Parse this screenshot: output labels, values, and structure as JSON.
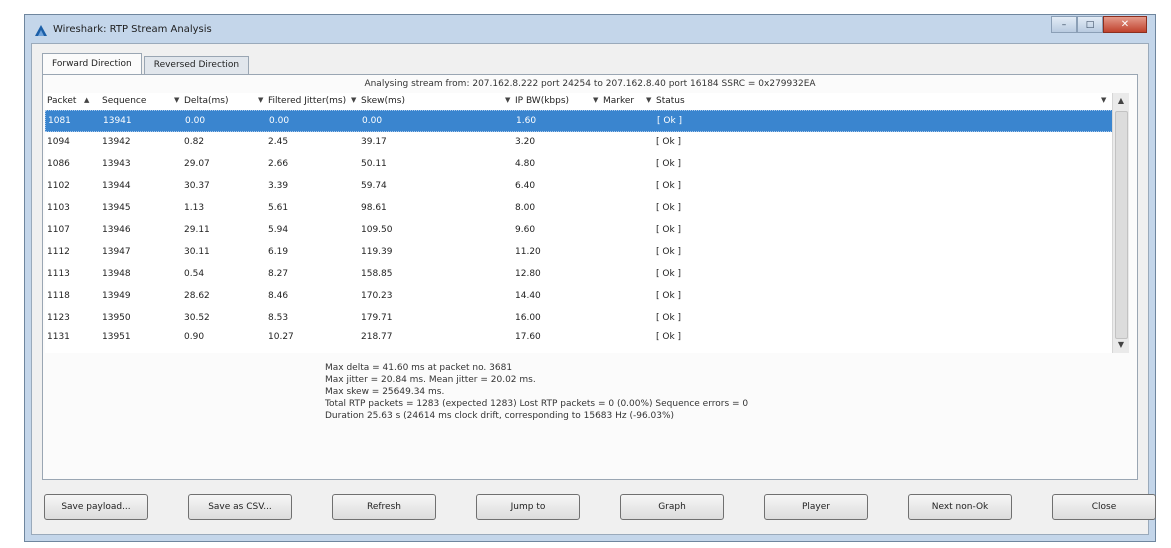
{
  "window": {
    "title": "Wireshark: RTP Stream Analysis",
    "controls": {
      "minimize": "–",
      "maximize": "□",
      "close": "✕"
    }
  },
  "tabs": [
    {
      "label": "Forward Direction",
      "active": true
    },
    {
      "label": "Reversed Direction",
      "active": false
    }
  ],
  "stream_info": "Analysing stream from: 207.162.8.222 port 24254 to 207.162.8.40 port 16184 SSRC = 0x279932EA",
  "table": {
    "columns": [
      "Packet",
      "Sequence",
      "Delta(ms)",
      "Filtered Jitter(ms)",
      "Skew(ms)",
      "IP BW(kbps)",
      "Marker",
      "Status"
    ],
    "rows": [
      [
        "1081",
        "13941",
        "0.00",
        "0.00",
        "0.00",
        "1.60",
        "",
        "[ Ok ]"
      ],
      [
        "1094",
        "13942",
        "0.82",
        "2.45",
        "39.17",
        "3.20",
        "",
        "[ Ok ]"
      ],
      [
        "1086",
        "13943",
        "29.07",
        "2.66",
        "50.11",
        "4.80",
        "",
        "[ Ok ]"
      ],
      [
        "1102",
        "13944",
        "30.37",
        "3.39",
        "59.74",
        "6.40",
        "",
        "[ Ok ]"
      ],
      [
        "1103",
        "13945",
        "1.13",
        "5.61",
        "98.61",
        "8.00",
        "",
        "[ Ok ]"
      ],
      [
        "1107",
        "13946",
        "29.11",
        "5.94",
        "109.50",
        "9.60",
        "",
        "[ Ok ]"
      ],
      [
        "1112",
        "13947",
        "30.11",
        "6.19",
        "119.39",
        "11.20",
        "",
        "[ Ok ]"
      ],
      [
        "1113",
        "13948",
        "0.54",
        "8.27",
        "158.85",
        "12.80",
        "",
        "[ Ok ]"
      ],
      [
        "1118",
        "13949",
        "28.62",
        "8.46",
        "170.23",
        "14.40",
        "",
        "[ Ok ]"
      ],
      [
        "1123",
        "13950",
        "30.52",
        "8.53",
        "179.71",
        "16.00",
        "",
        "[ Ok ]"
      ],
      [
        "1131",
        "13951",
        "0.90",
        "10.27",
        "218.77",
        "17.60",
        "",
        "[ Ok ]"
      ]
    ],
    "selected_row": 0
  },
  "stats": [
    "Max delta = 41.60 ms at packet no. 3681",
    "Max jitter = 20.84 ms. Mean jitter = 20.02 ms.",
    "Max skew = 25649.34 ms.",
    "Total RTP packets = 1283 (expected 1283) Lost RTP packets = 0 (0.00%) Sequence errors = 0",
    "Duration 25.63 s (24614 ms clock drift, corresponding to 15683 Hz (-96.03%)"
  ],
  "buttons": [
    "Save payload...",
    "Save as CSV...",
    "Refresh",
    "Jump to",
    "Graph",
    "Player",
    "Next non-Ok",
    "Close"
  ],
  "icons": {
    "app": "wireshark-fin-icon",
    "sort": "sort-arrow-icon"
  },
  "colors": {
    "selection": "#3a85cf",
    "window_frame": "#c4d6ea",
    "close_button": "#c0422d"
  }
}
